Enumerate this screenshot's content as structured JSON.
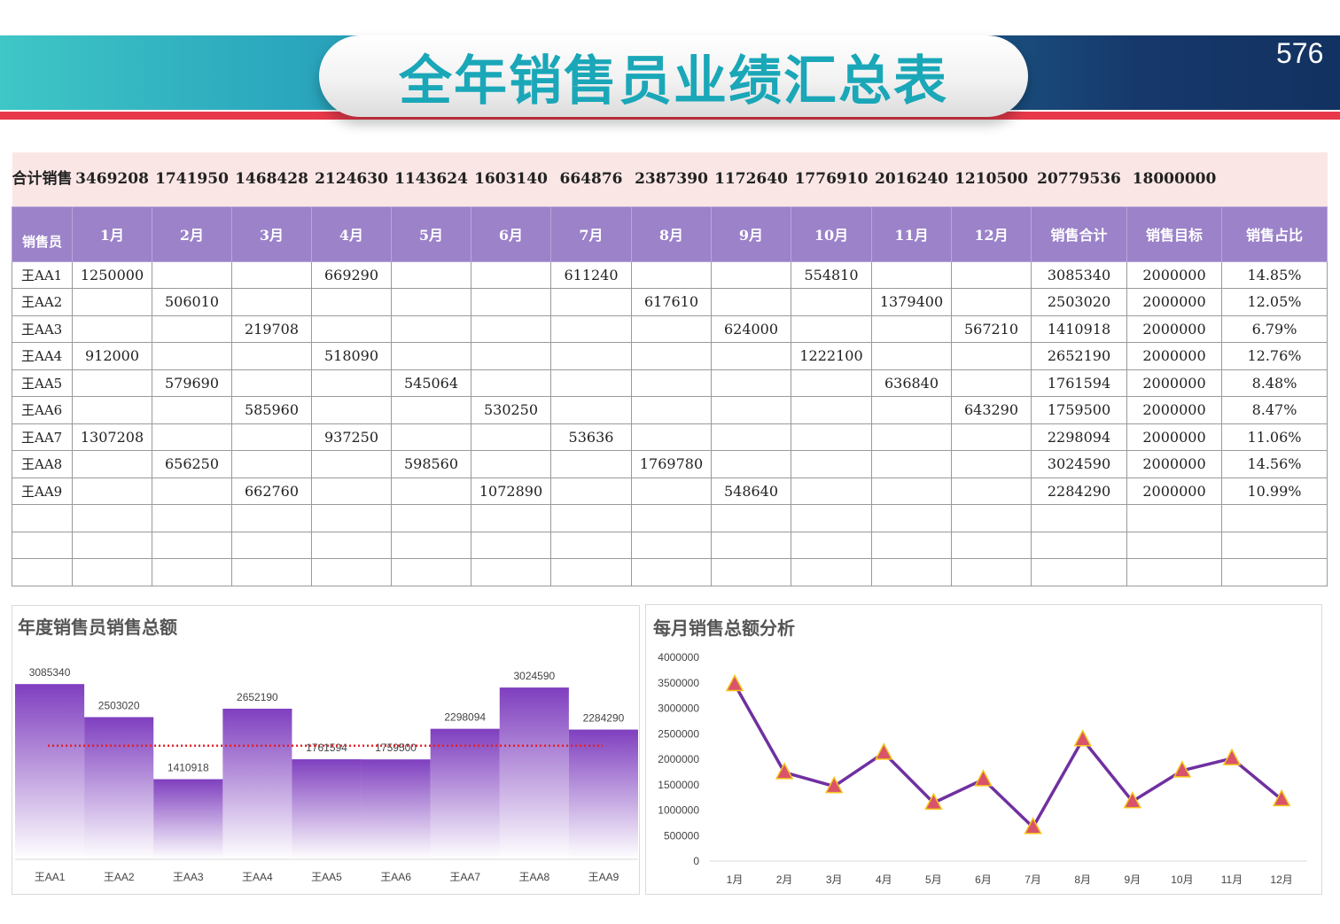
{
  "header": {
    "title": "全年销售员业绩汇总表",
    "page_number": "576"
  },
  "table": {
    "total_label": "合计销售",
    "totals": [
      "3469208",
      "1741950",
      "1468428",
      "2124630",
      "1143624",
      "1603140",
      "664876",
      "2387390",
      "1172640",
      "1776910",
      "2016240",
      "1210500",
      "20779536",
      "18000000"
    ],
    "headers": [
      "销售员",
      "1月",
      "2月",
      "3月",
      "4月",
      "5月",
      "6月",
      "7月",
      "8月",
      "9月",
      "10月",
      "11月",
      "12月",
      "销售合计",
      "销售目标",
      "销售占比"
    ],
    "rows": [
      [
        "王AA1",
        "1250000",
        "",
        "",
        "669290",
        "",
        "",
        "611240",
        "",
        "",
        "554810",
        "",
        "",
        "3085340",
        "2000000",
        "14.85%"
      ],
      [
        "王AA2",
        "",
        "506010",
        "",
        "",
        "",
        "",
        "",
        "617610",
        "",
        "",
        "1379400",
        "",
        "2503020",
        "2000000",
        "12.05%"
      ],
      [
        "王AA3",
        "",
        "",
        "219708",
        "",
        "",
        "",
        "",
        "",
        "624000",
        "",
        "",
        "567210",
        "1410918",
        "2000000",
        "6.79%"
      ],
      [
        "王AA4",
        "912000",
        "",
        "",
        "518090",
        "",
        "",
        "",
        "",
        "",
        "1222100",
        "",
        "",
        "2652190",
        "2000000",
        "12.76%"
      ],
      [
        "王AA5",
        "",
        "579690",
        "",
        "",
        "545064",
        "",
        "",
        "",
        "",
        "",
        "636840",
        "",
        "1761594",
        "2000000",
        "8.48%"
      ],
      [
        "王AA6",
        "",
        "",
        "585960",
        "",
        "",
        "530250",
        "",
        "",
        "",
        "",
        "",
        "643290",
        "1759500",
        "2000000",
        "8.47%"
      ],
      [
        "王AA7",
        "1307208",
        "",
        "",
        "937250",
        "",
        "",
        "53636",
        "",
        "",
        "",
        "",
        "",
        "2298094",
        "2000000",
        "11.06%"
      ],
      [
        "王AA8",
        "",
        "656250",
        "",
        "",
        "598560",
        "",
        "",
        "1769780",
        "",
        "",
        "",
        "",
        "3024590",
        "2000000",
        "14.56%"
      ],
      [
        "王AA9",
        "",
        "",
        "662760",
        "",
        "",
        "1072890",
        "",
        "",
        "548640",
        "",
        "",
        "",
        "2284290",
        "2000000",
        "10.99%"
      ],
      [
        "",
        "",
        "",
        "",
        "",
        "",
        "",
        "",
        "",
        "",
        "",
        "",
        "",
        "",
        "",
        ""
      ],
      [
        "",
        "",
        "",
        "",
        "",
        "",
        "",
        "",
        "",
        "",
        "",
        "",
        "",
        "",
        "",
        ""
      ],
      [
        "",
        "",
        "",
        "",
        "",
        "",
        "",
        "",
        "",
        "",
        "",
        "",
        "",
        "",
        "",
        ""
      ]
    ]
  },
  "colors": {
    "header_purple": "#9b82c9",
    "total_row_pink": "#fbe6e6",
    "bar_purple": "#7f3fbf",
    "line_purple": "#7030a0",
    "marker_fill": "#d9536b",
    "marker_stroke": "#f5c518",
    "avg_line_red": "#e0202a",
    "title_teal": "#1aa7b8",
    "banner_red": "#e8394b"
  },
  "chart_data": [
    {
      "type": "bar",
      "title": "年度销售员销售总额",
      "categories": [
        "王AA1",
        "王AA2",
        "王AA3",
        "王AA4",
        "王AA5",
        "王AA6",
        "王AA7",
        "王AA8",
        "王AA9"
      ],
      "values": [
        3085340,
        2503020,
        1410918,
        2652190,
        1761594,
        1759500,
        2298094,
        3024590,
        2284290
      ],
      "reference_line": 2000000,
      "ylim": [
        0,
        3400000
      ],
      "xlabel": "",
      "ylabel": "",
      "data_labels": true,
      "grid": false
    },
    {
      "type": "line",
      "title": "每月销售总额分析",
      "categories": [
        "1月",
        "2月",
        "3月",
        "4月",
        "5月",
        "6月",
        "7月",
        "8月",
        "9月",
        "10月",
        "11月",
        "12月"
      ],
      "values": [
        3469208,
        1741950,
        1468428,
        2124630,
        1143624,
        1603140,
        664876,
        2387390,
        1172640,
        1776910,
        2016240,
        1210500
      ],
      "yticks": [
        "4000000",
        "3500000",
        "3000000",
        "2500000",
        "2000000",
        "1500000",
        "1000000",
        "500000",
        "0"
      ],
      "ylim": [
        0,
        4000000
      ],
      "xlabel": "",
      "ylabel": "",
      "marker": "triangle",
      "grid": false
    }
  ]
}
